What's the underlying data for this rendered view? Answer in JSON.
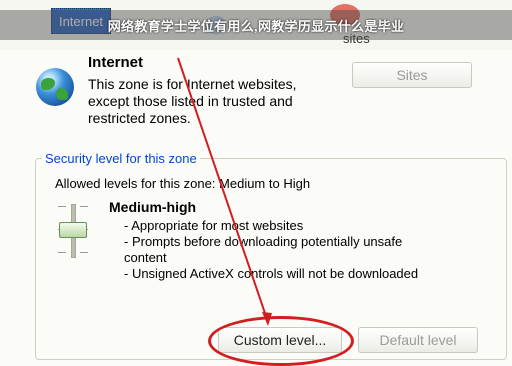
{
  "tabs": {
    "internet": "Internet",
    "sites_fragment": "sites"
  },
  "banner": {
    "text": "网络教育学士学位有用么,网教学历显示什么是毕业"
  },
  "zone": {
    "title": "Internet",
    "description": "This zone is for Internet websites, except those listed in trusted and restricted zones.",
    "sites_button": "Sites"
  },
  "security": {
    "legend": "Security level for this zone",
    "allowed": "Allowed levels for this zone: Medium to High",
    "level_name": "Medium-high",
    "bullets": [
      "- Appropriate for most websites",
      "- Prompts before downloading potentially unsafe content",
      "- Unsigned ActiveX controls will not be downloaded"
    ],
    "slider_level": 0.4
  },
  "buttons": {
    "custom_level": "Custom level...",
    "default_level": "Default level"
  },
  "colors": {
    "selection": "#316ac5",
    "annotation": "#d21e1e",
    "legend_text": "#0046d5"
  }
}
